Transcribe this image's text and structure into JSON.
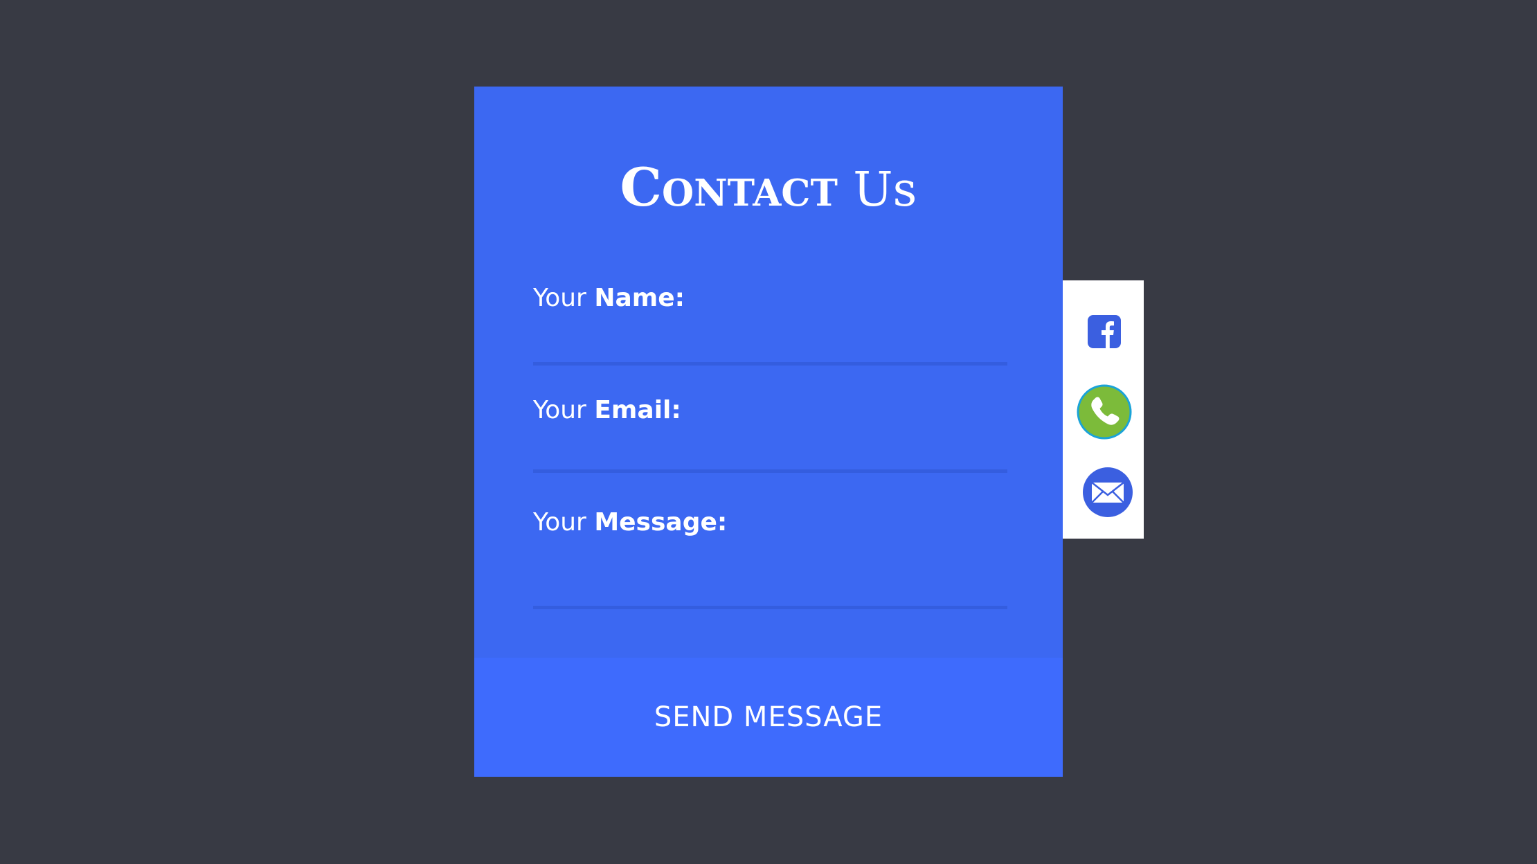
{
  "form": {
    "title_bold": "Contact",
    "title_light": "Us",
    "fields": [
      {
        "prefix": "Your",
        "label": "Name:",
        "value": ""
      },
      {
        "prefix": "Your",
        "label": "Email:",
        "value": ""
      },
      {
        "prefix": "Your",
        "label": "Message:",
        "value": ""
      }
    ],
    "submit_label": "SEND MESSAGE"
  },
  "social": {
    "icons": [
      "facebook-icon",
      "phone-icon",
      "mail-icon"
    ]
  },
  "colors": {
    "background": "#383a44",
    "card": "#3c68f2",
    "button": "#3e6bfd",
    "underline": "#345ddf",
    "social_panel": "#ffffff",
    "facebook": "#3b5fe0",
    "phone": "#7cbb3a",
    "phone_ring": "#1aa3d8",
    "mail": "#3b5fe0"
  }
}
